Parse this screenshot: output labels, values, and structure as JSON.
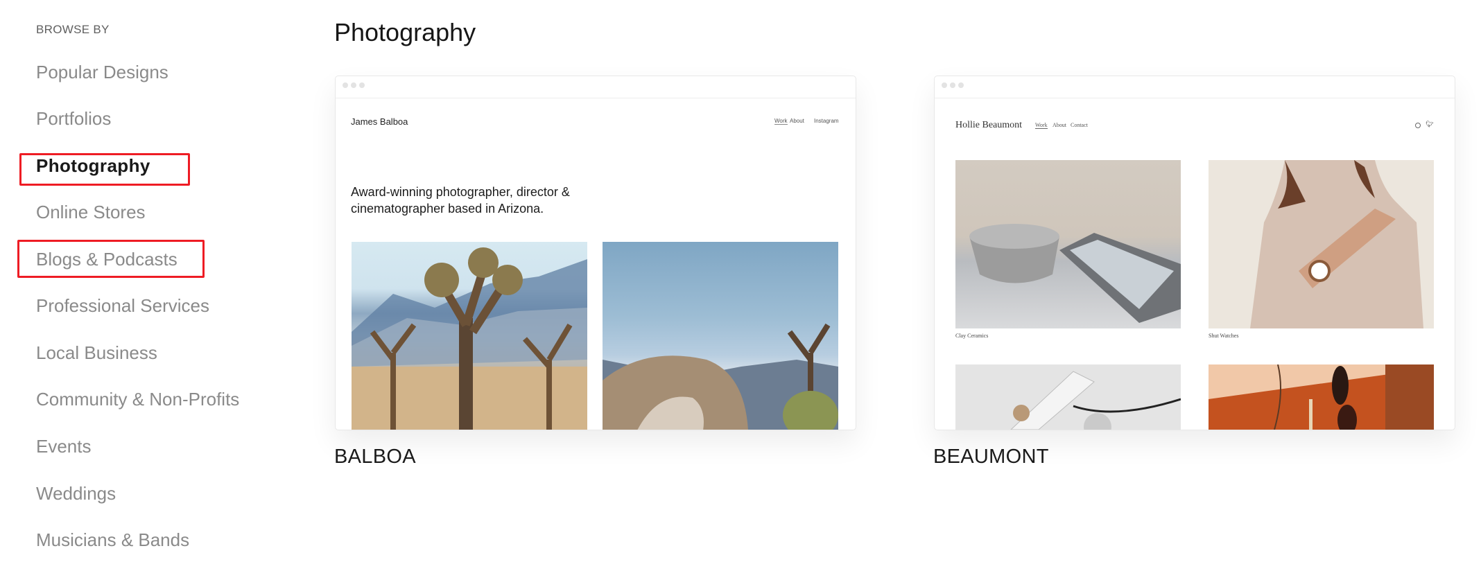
{
  "sidebar": {
    "heading": "BROWSE BY",
    "items": [
      {
        "label": "Popular Designs",
        "active": false
      },
      {
        "label": "Portfolios",
        "active": false
      },
      {
        "label": "Photography",
        "active": true
      },
      {
        "label": "Online Stores",
        "active": false
      },
      {
        "label": "Blogs & Podcasts",
        "active": false
      },
      {
        "label": "Professional Services",
        "active": false
      },
      {
        "label": "Local Business",
        "active": false
      },
      {
        "label": "Community & Non-Profits",
        "active": false
      },
      {
        "label": "Events",
        "active": false
      },
      {
        "label": "Weddings",
        "active": false
      },
      {
        "label": "Musicians & Bands",
        "active": false
      }
    ],
    "highlight_color": "#ee1c24"
  },
  "main": {
    "title": "Photography",
    "templates": [
      {
        "name": "BALBOA",
        "preview": {
          "site_name": "James Balboa",
          "nav": [
            "Work",
            "About",
            "Instagram"
          ],
          "headline_line1": "Award-winning photographer, director &",
          "headline_line2": "cinematographer based in Arizona.",
          "images": [
            "joshua-tree-desert-image",
            "rock-arch-desert-image"
          ]
        }
      },
      {
        "name": "BEAUMONT",
        "preview": {
          "site_name": "Hollie Beaumont",
          "nav": [
            "Work",
            "About",
            "Contact"
          ],
          "social_icons": [
            "instagram-icon",
            "twitter-icon"
          ],
          "items": [
            {
              "caption": "Clay Ceramics",
              "image": "ceramic-bowl-image"
            },
            {
              "caption": "Shut Watches",
              "image": "watch-sweater-image"
            },
            {
              "caption": "",
              "image": "power-strip-image"
            },
            {
              "caption": "",
              "image": "sunglasses-orange-image"
            }
          ]
        }
      }
    ]
  }
}
